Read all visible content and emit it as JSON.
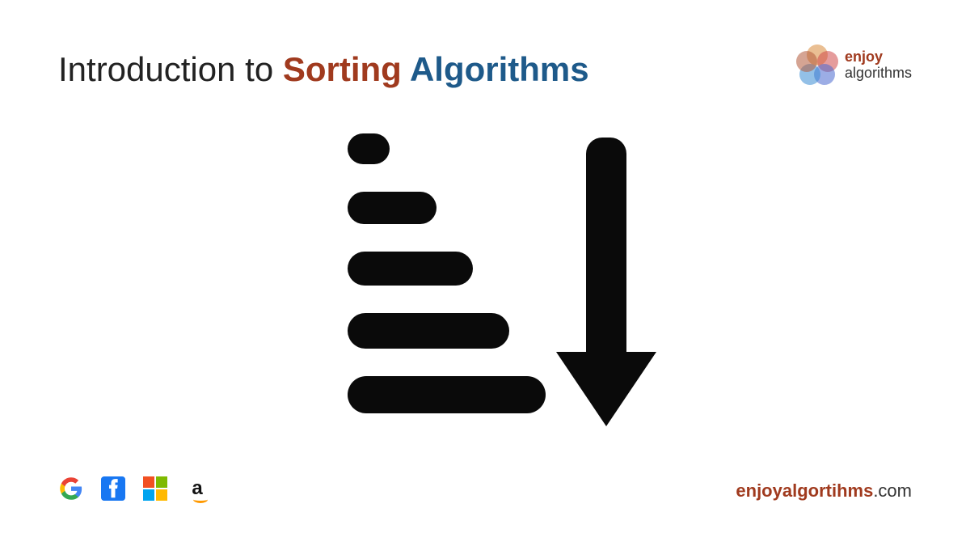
{
  "title": {
    "prefix": "Introduction to ",
    "highlight1": "Sorting",
    "highlight2": " Algorithms"
  },
  "logo": {
    "line1": "enjoy",
    "line2": "algorithms"
  },
  "footer": {
    "icons": [
      "google",
      "facebook",
      "microsoft",
      "amazon"
    ],
    "website_brand": "enjoyalgortihms",
    "website_suffix": ".com"
  },
  "center_icon": "sort-descending"
}
